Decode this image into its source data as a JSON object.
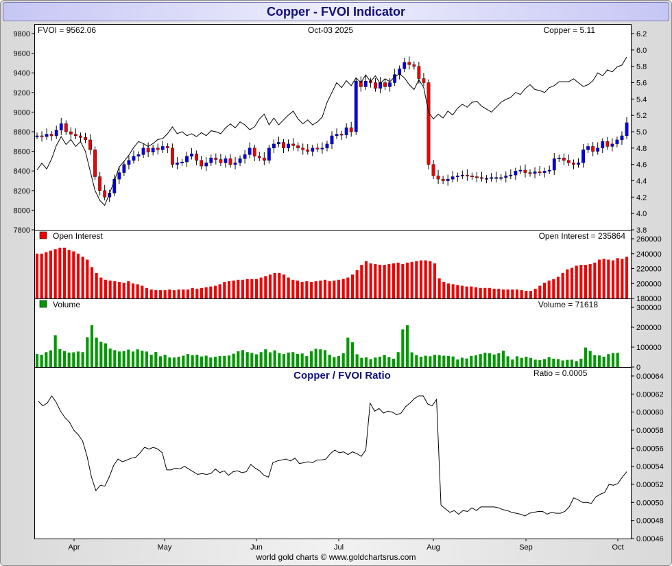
{
  "title": "Copper - FVOI Indicator",
  "footer": "world gold charts © www.goldchartsrus.com",
  "colors": {
    "up": "#0000ee",
    "down": "#ee0000",
    "open_interest": "#ee0000",
    "volume": "#009900",
    "line": "#000000",
    "title": "#10107a"
  },
  "chart_data": [
    {
      "type": "candlestick",
      "panel": "FVOI",
      "labels": {
        "left": "FVOI = 9562.06",
        "center": "Oct-03  2025",
        "right": "Copper = 5.11"
      },
      "left_axis": {
        "min": 7800,
        "max": 9800,
        "ticks": [
          7800,
          8000,
          8200,
          8400,
          8600,
          8800,
          9000,
          9200,
          9400,
          9600,
          9800
        ]
      },
      "right_axis": {
        "min": 3.8,
        "max": 6.2,
        "ticks": [
          "3.8",
          "4.0",
          "4.2",
          "4.4",
          "4.6",
          "4.8",
          "5.0",
          "5.2",
          "5.4",
          "5.6",
          "5.8",
          "6.0",
          "6.2"
        ]
      },
      "x_labels": [
        "Apr",
        "May",
        "Jun",
        "Jul",
        "Aug",
        "Sep",
        "Oct"
      ],
      "candles_close": [
        4.95,
        4.94,
        4.97,
        4.95,
        5.02,
        5.1,
        5.0,
        4.97,
        4.95,
        4.93,
        4.9,
        4.78,
        4.45,
        4.28,
        4.2,
        4.25,
        4.42,
        4.5,
        4.6,
        4.65,
        4.7,
        4.72,
        4.8,
        4.75,
        4.8,
        4.78,
        4.82,
        4.8,
        4.6,
        4.62,
        4.63,
        4.7,
        4.73,
        4.65,
        4.58,
        4.62,
        4.68,
        4.66,
        4.62,
        4.67,
        4.6,
        4.62,
        4.67,
        4.72,
        4.8,
        4.7,
        4.68,
        4.65,
        4.8,
        4.85,
        4.87,
        4.8,
        4.85,
        4.83,
        4.8,
        4.78,
        4.76,
        4.8,
        4.79,
        4.8,
        4.85,
        4.95,
        4.97,
        4.96,
        5.05,
        5.0,
        5.62,
        5.55,
        5.62,
        5.6,
        5.53,
        5.6,
        5.55,
        5.6,
        5.7,
        5.77,
        5.85,
        5.82,
        5.8,
        5.65,
        5.6,
        4.6,
        4.46,
        4.42,
        4.4,
        4.42,
        4.45,
        4.46,
        4.47,
        4.46,
        4.45,
        4.44,
        4.43,
        4.43,
        4.44,
        4.44,
        4.44,
        4.46,
        4.47,
        4.52,
        4.53,
        4.5,
        4.49,
        4.51,
        4.5,
        4.52,
        4.53,
        4.67,
        4.68,
        4.65,
        4.62,
        4.6,
        4.62,
        4.78,
        4.82,
        4.76,
        4.8,
        4.88,
        4.82,
        4.85,
        4.9,
        4.95,
        5.11
      ],
      "line_fvoi": [
        8410,
        8480,
        8420,
        8520,
        8660,
        8750,
        8670,
        8720,
        8650,
        8700,
        8600,
        8400,
        8200,
        8100,
        8050,
        8170,
        8300,
        8440,
        8500,
        8560,
        8640,
        8700,
        8680,
        8650,
        8680,
        8720,
        8730,
        8780,
        8850,
        8780,
        8800,
        8760,
        8780,
        8750,
        8790,
        8760,
        8810,
        8800,
        8780,
        8840,
        8880,
        8840,
        8900,
        8870,
        8820,
        8850,
        8930,
        8980,
        8870,
        8940,
        8870,
        8920,
        8970,
        9010,
        8930,
        8880,
        8920,
        8870,
        8900,
        8950,
        9100,
        9200,
        9300,
        9250,
        9320,
        9270,
        9350,
        9300,
        9380,
        9310,
        9370,
        9290,
        9340,
        9310,
        9360,
        9390,
        9350,
        9280,
        9230,
        9330,
        9250,
        9000,
        8930,
        8980,
        8940,
        9010,
        8970,
        9040,
        9080,
        9050,
        9100,
        9110,
        9060,
        9030,
        9000,
        9050,
        9100,
        9130,
        9150,
        9200,
        9180,
        9240,
        9280,
        9230,
        9220,
        9200,
        9250,
        9270,
        9310,
        9310,
        9310,
        9340,
        9300,
        9260,
        9280,
        9320,
        9400,
        9370,
        9430,
        9410,
        9460,
        9480,
        9562
      ]
    },
    {
      "type": "bar",
      "panel": "Open Interest",
      "legend": "Open Interest",
      "label_right": "Open Interest = 235864",
      "axis": {
        "min": 180000,
        "max": 260000,
        "ticks": [
          "180000",
          "200000",
          "220000",
          "240000",
          "260000"
        ]
      },
      "values": [
        240000,
        240000,
        242000,
        244000,
        246000,
        248000,
        248000,
        245000,
        243000,
        240000,
        236000,
        232000,
        222000,
        214000,
        208000,
        205000,
        204000,
        203000,
        202000,
        201000,
        203000,
        200000,
        199000,
        197000,
        194000,
        192000,
        191000,
        191000,
        191000,
        192000,
        191000,
        192000,
        192000,
        192000,
        194000,
        193000,
        194000,
        195000,
        196000,
        197000,
        199000,
        202000,
        203000,
        204000,
        205000,
        205000,
        206000,
        206000,
        206000,
        208000,
        210000,
        212000,
        214000,
        214000,
        212000,
        208000,
        205000,
        204000,
        202000,
        203000,
        202000,
        203000,
        204000,
        205000,
        203000,
        204000,
        205000,
        206000,
        208000,
        212000,
        218000,
        225000,
        230000,
        227000,
        226000,
        225000,
        225000,
        226000,
        227000,
        228000,
        226000,
        228000,
        229000,
        230000,
        231000,
        231000,
        230000,
        227000,
        207000,
        202000,
        200000,
        199000,
        198000,
        197000,
        196000,
        196000,
        195000,
        194000,
        194000,
        194000,
        193000,
        193000,
        192000,
        192000,
        192000,
        192000,
        191000,
        190000,
        190000,
        193000,
        197000,
        201000,
        204000,
        206000,
        209000,
        214000,
        219000,
        221000,
        224000,
        225000,
        225000,
        226000,
        228000,
        232000,
        233000,
        232000,
        231000,
        234000,
        233000,
        235864
      ]
    },
    {
      "type": "bar",
      "panel": "Volume",
      "legend": "Volume",
      "label_right": "Volume = 71618",
      "axis": {
        "min": 0,
        "max": 300000,
        "ticks": [
          "0",
          "100000",
          "200000",
          "300000"
        ]
      },
      "values": [
        66000,
        62000,
        75000,
        84000,
        160000,
        90000,
        80000,
        73000,
        74000,
        78000,
        75000,
        150000,
        210000,
        148000,
        127000,
        119000,
        93000,
        85000,
        78000,
        80000,
        88000,
        78000,
        89000,
        82000,
        78000,
        62000,
        76000,
        54000,
        62000,
        48000,
        48000,
        52000,
        57000,
        65000,
        60000,
        62000,
        53000,
        57000,
        48000,
        52000,
        55000,
        56000,
        58000,
        67000,
        79000,
        85000,
        75000,
        71000,
        64000,
        75000,
        89000,
        74000,
        84000,
        70000,
        65000,
        73000,
        75000,
        66000,
        68000,
        55000,
        79000,
        92000,
        89000,
        85000,
        62000,
        50000,
        55000,
        69000,
        148000,
        125000,
        64000,
        46000,
        49000,
        40000,
        48000,
        52000,
        61000,
        50000,
        42000,
        75000,
        189000,
        210000,
        74000,
        60000,
        52000,
        57000,
        54000,
        62000,
        60000,
        57000,
        55000,
        53000,
        38000,
        47000,
        43000,
        56000,
        59000,
        65000,
        72000,
        69000,
        63000,
        69000,
        82000,
        54000,
        38000,
        54000,
        46000,
        52000,
        46000,
        37000,
        35000,
        40000,
        50000,
        42000,
        40000,
        33000,
        36000,
        37000,
        30000,
        42000,
        98000,
        81000,
        60000,
        58000,
        52000,
        65000,
        70000,
        71618
      ]
    },
    {
      "type": "line",
      "panel": "Ratio",
      "title": "Copper / FVOI Ratio",
      "label_right": "Ratio = 0.0005",
      "axis": {
        "min": 0.00046,
        "max": 0.00064,
        "ticks": [
          "0.00046",
          "0.00048",
          "0.00050",
          "0.00052",
          "0.00054",
          "0.00056",
          "0.00058",
          "0.00060",
          "0.00062",
          "0.00064"
        ]
      },
      "values": [
        0.000612,
        0.000607,
        0.00061,
        0.000618,
        0.000611,
        0.000601,
        0.000594,
        0.000589,
        0.00058,
        0.000575,
        0.000568,
        0.000551,
        0.000528,
        0.000513,
        0.000519,
        0.000518,
        0.000528,
        0.000541,
        0.000548,
        0.000545,
        0.000547,
        0.000549,
        0.00055,
        0.000555,
        0.000561,
        0.000559,
        0.000561,
        0.000559,
        0.000555,
        0.000536,
        0.000536,
        0.000538,
        0.000537,
        0.00054,
        0.000537,
        0.000534,
        0.000531,
        0.000532,
        0.000531,
        0.000532,
        0.000537,
        0.000533,
        0.000535,
        0.00053,
        0.000534,
        0.000535,
        0.000533,
        0.000534,
        0.000542,
        0.000538,
        0.000535,
        0.00053,
        0.000528,
        0.000544,
        0.000546,
        0.000547,
        0.000548,
        0.000546,
        0.000549,
        0.000543,
        0.000544,
        0.000545,
        0.000544,
        0.000547,
        0.000547,
        0.000548,
        0.000554,
        0.000558,
        0.000555,
        0.000556,
        0.000553,
        0.000556,
        0.000554,
        0.000551,
        0.000558,
        0.00061,
        0.000601,
        0.000604,
        0.000599,
        0.000601,
        0.0006,
        0.000597,
        0.000599,
        0.000606,
        0.00061,
        0.000615,
        0.000618,
        0.000618,
        0.000609,
        0.000607,
        0.000614,
        0.000497,
        0.000493,
        0.000489,
        0.000491,
        0.000487,
        0.000491,
        0.00049,
        0.000494,
        0.000491,
        0.000495,
        0.000495,
        0.000495,
        0.000495,
        0.000494,
        0.000492,
        0.000491,
        0.000489,
        0.000488,
        0.000487,
        0.000485,
        0.000488,
        0.000489,
        0.00049,
        0.00049,
        0.000487,
        0.000489,
        0.000488,
        0.000488,
        0.00049,
        0.000495,
        0.000505,
        0.000503,
        0.0005,
        0.0005,
        0.000499,
        0.000506,
        0.000509,
        0.000511,
        0.00052,
        0.000519,
        0.000521,
        0.000528,
        0.000534
      ]
    }
  ]
}
